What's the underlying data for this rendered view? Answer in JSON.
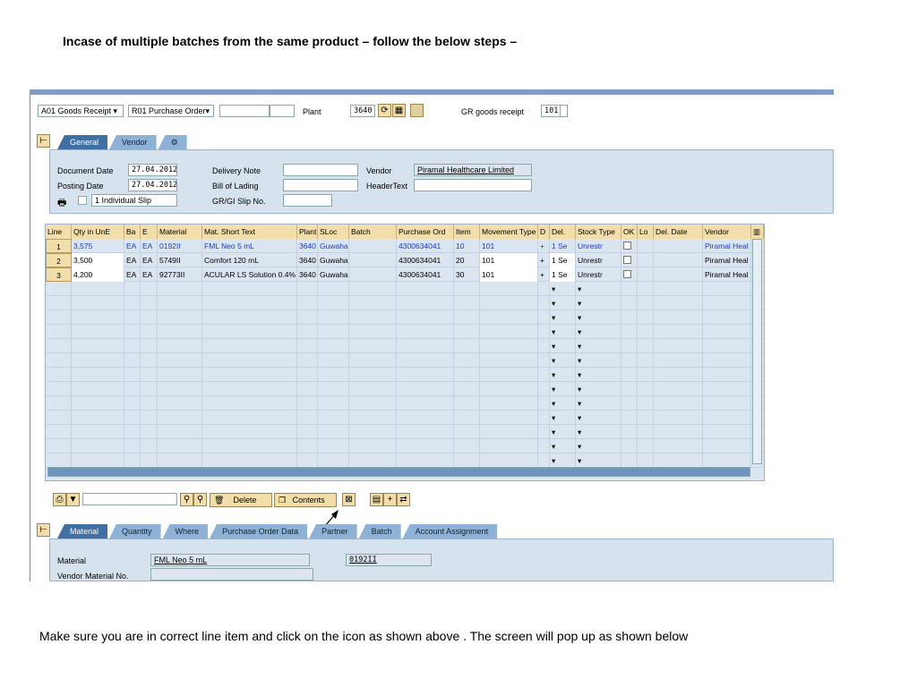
{
  "heading": "Incase of multiple batches from the same product – follow the below steps –",
  "footer": "Make sure you are in correct line item and click on the icon as shown above . The screen will pop up as shown below",
  "header": {
    "action": "A01 Goods Receipt",
    "reference": "R01 Purchase Order",
    "plant_label": "Plant",
    "plant": "3640",
    "gr_label": "GR goods receipt",
    "movement_type": "101"
  },
  "top_tabs": [
    "General",
    "Vendor"
  ],
  "general": {
    "doc_date_label": "Document Date",
    "doc_date": "27.04.2012",
    "post_date_label": "Posting Date",
    "post_date": "27.04.2012",
    "slip": "1 Individual Slip",
    "delivery_note_label": "Delivery Note",
    "bol_label": "Bill of Lading",
    "grgi_label": "GR/GI Slip No.",
    "vendor_label": "Vendor",
    "vendor": "Piramal Healthcare Limited",
    "headertext_label": "HeaderText"
  },
  "columns": [
    "Line",
    "Qty in UnE",
    "Ba",
    "E",
    "Material",
    "Mat. Short Text",
    "Plant",
    "SLoc",
    "Batch",
    "Purchase Ord",
    "Item",
    "Movement Type",
    "D",
    "Del.",
    "Stock Type",
    "OK",
    "Lo",
    "Del. Date",
    "Vendor"
  ],
  "rows": [
    [
      "1",
      "3,575",
      "EA",
      "EA",
      "0192II",
      "FML Neo 5 mL",
      "3640",
      "Guwaha",
      "",
      "4300634041",
      "10",
      "101",
      "+",
      "1 Se",
      "Unrestr",
      "",
      "",
      "",
      "Piramal Heal"
    ],
    [
      "2",
      "3,500",
      "EA",
      "EA",
      "5749II",
      " Comfort 120 mL",
      "3640",
      "Guwaha",
      "",
      "4300634041",
      "20",
      "101",
      "+",
      "1 Se",
      "Unrestr",
      "",
      "",
      "",
      "Piramal Heal"
    ],
    [
      "3",
      "4,200",
      "EA",
      "EA",
      "92773II",
      "ACULAR LS Solution 0.4%",
      "3640",
      "Guwaha",
      "",
      "4300634041",
      "30",
      "101",
      "+",
      "1 Se",
      "Unrestr",
      "",
      "",
      "",
      "Piramal Heal"
    ]
  ],
  "toolbar": {
    "delete": "Delete",
    "contents": "Contents"
  },
  "detail_tabs": [
    "Material",
    "Quantity",
    "Where",
    "Purchase Order Data",
    "Partner",
    "Batch",
    "Account Assignment"
  ],
  "detail": {
    "material_label": "Material",
    "material_text": "FML Neo 5 mL",
    "material_no": "0192II",
    "vendor_mat_label": "Vendor Material No."
  },
  "colors": {
    "accent": "#3f6fa3",
    "header_cell": "#f2deaa",
    "panel": "#d6e2ee"
  }
}
